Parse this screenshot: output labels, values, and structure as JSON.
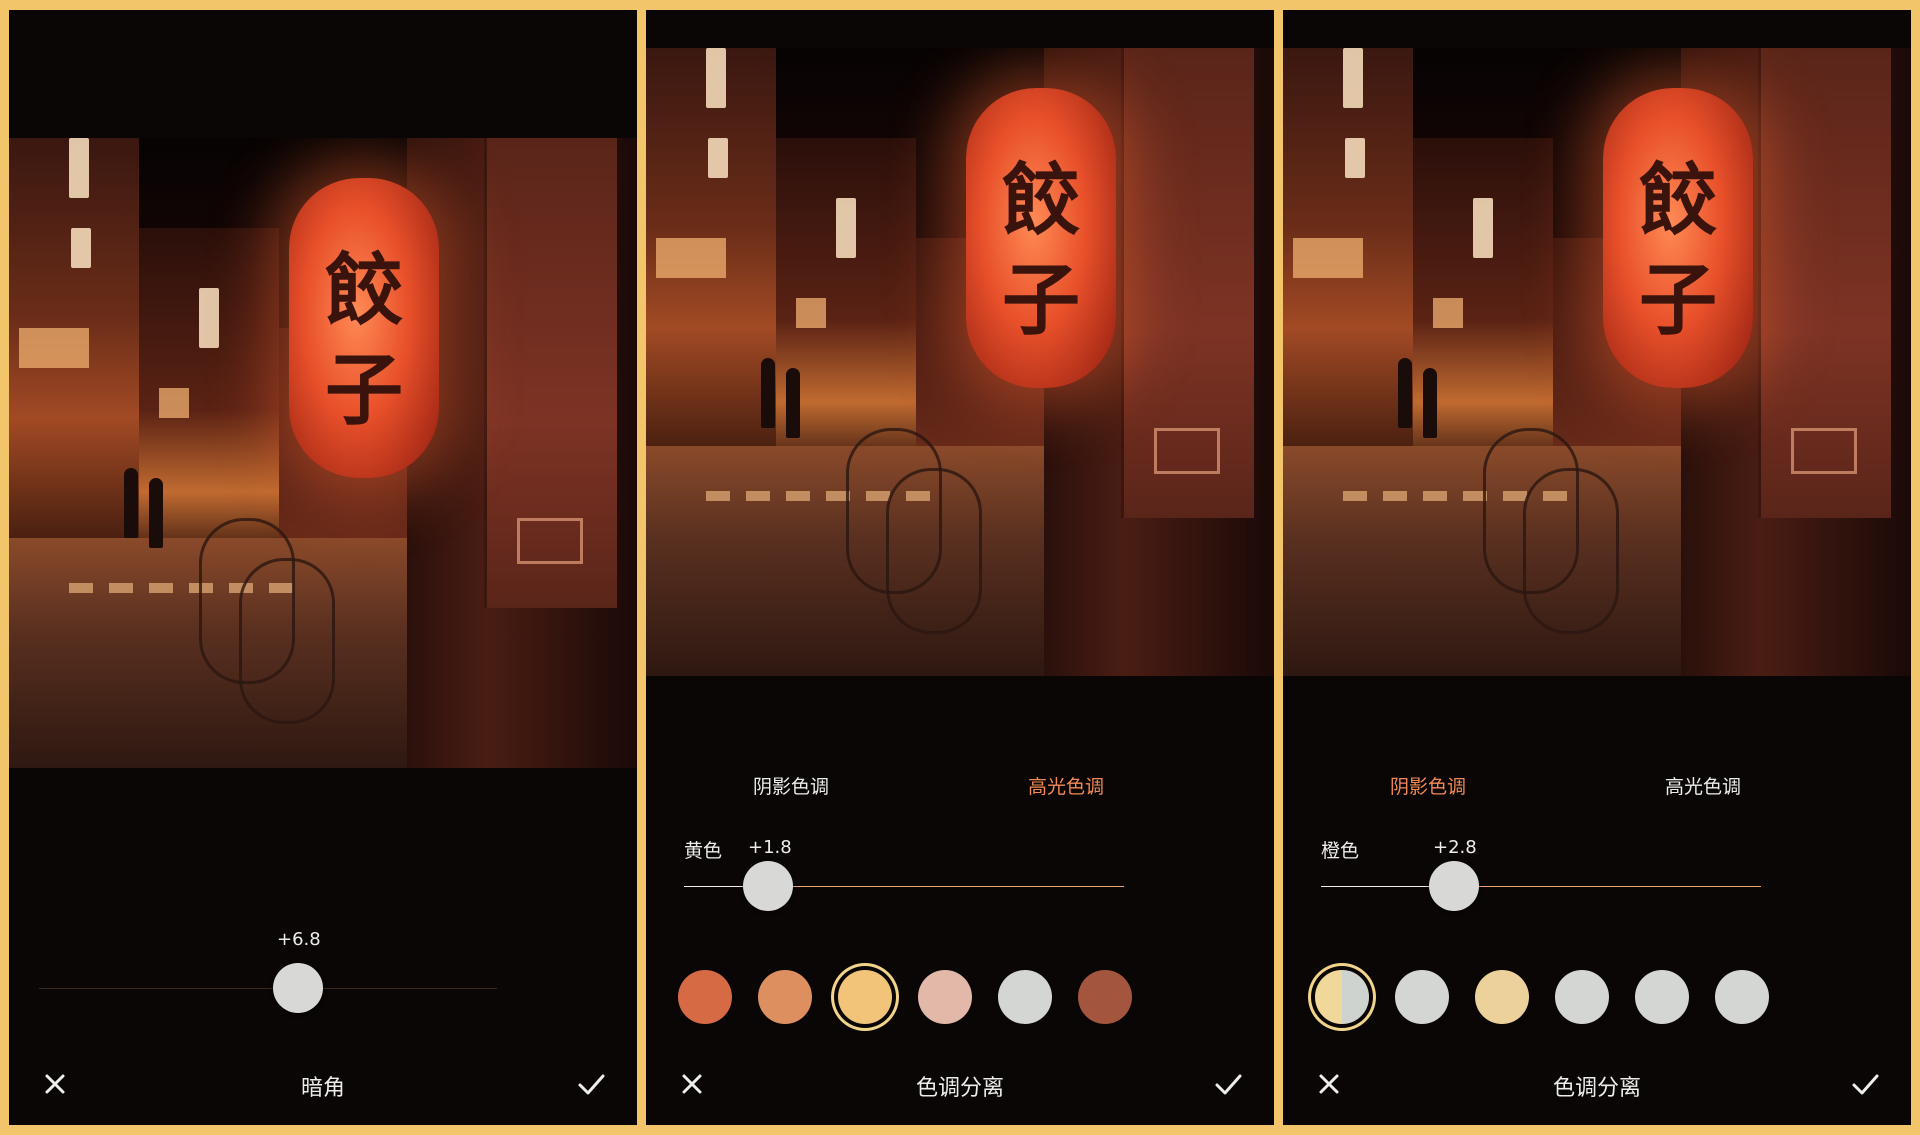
{
  "panels": [
    {
      "id": "vignette",
      "slider_value": "+6.8",
      "title": "暗角"
    },
    {
      "id": "split-toning-highlights",
      "tabs": [
        {
          "label": "阴影色调",
          "active": false
        },
        {
          "label": "高光色调",
          "active": true
        }
      ],
      "slider_label": "黄色",
      "slider_value": "+1.8",
      "title": "色调分离",
      "swatches": [
        "#d66a45",
        "#de8f5f",
        "#f2c47a",
        "#e2b8a8",
        "#d3d6d3",
        "#a3553d"
      ],
      "selected_swatch": 2
    },
    {
      "id": "split-toning-shadows",
      "tabs": [
        {
          "label": "阴影色调",
          "active": true
        },
        {
          "label": "高光色调",
          "active": false
        }
      ],
      "slider_label": "橙色",
      "slider_value": "+2.8",
      "title": "色调分离",
      "swatches": [
        "split",
        "#d3d6d3",
        "#ecd29a",
        "#d3d6d3",
        "#d3d6d3",
        "#d3d6d3"
      ],
      "selected_swatch": 0
    }
  ],
  "photo": {
    "lantern_text_1": "餃",
    "lantern_text_2": "子"
  },
  "icons": {
    "cancel": "close-icon",
    "confirm": "checkmark-icon"
  },
  "colors": {
    "background": "#0a0605",
    "frame": "#f2c56b",
    "accent": "#f28a55",
    "text": "#ededed",
    "knob": "#d8d8d6"
  }
}
